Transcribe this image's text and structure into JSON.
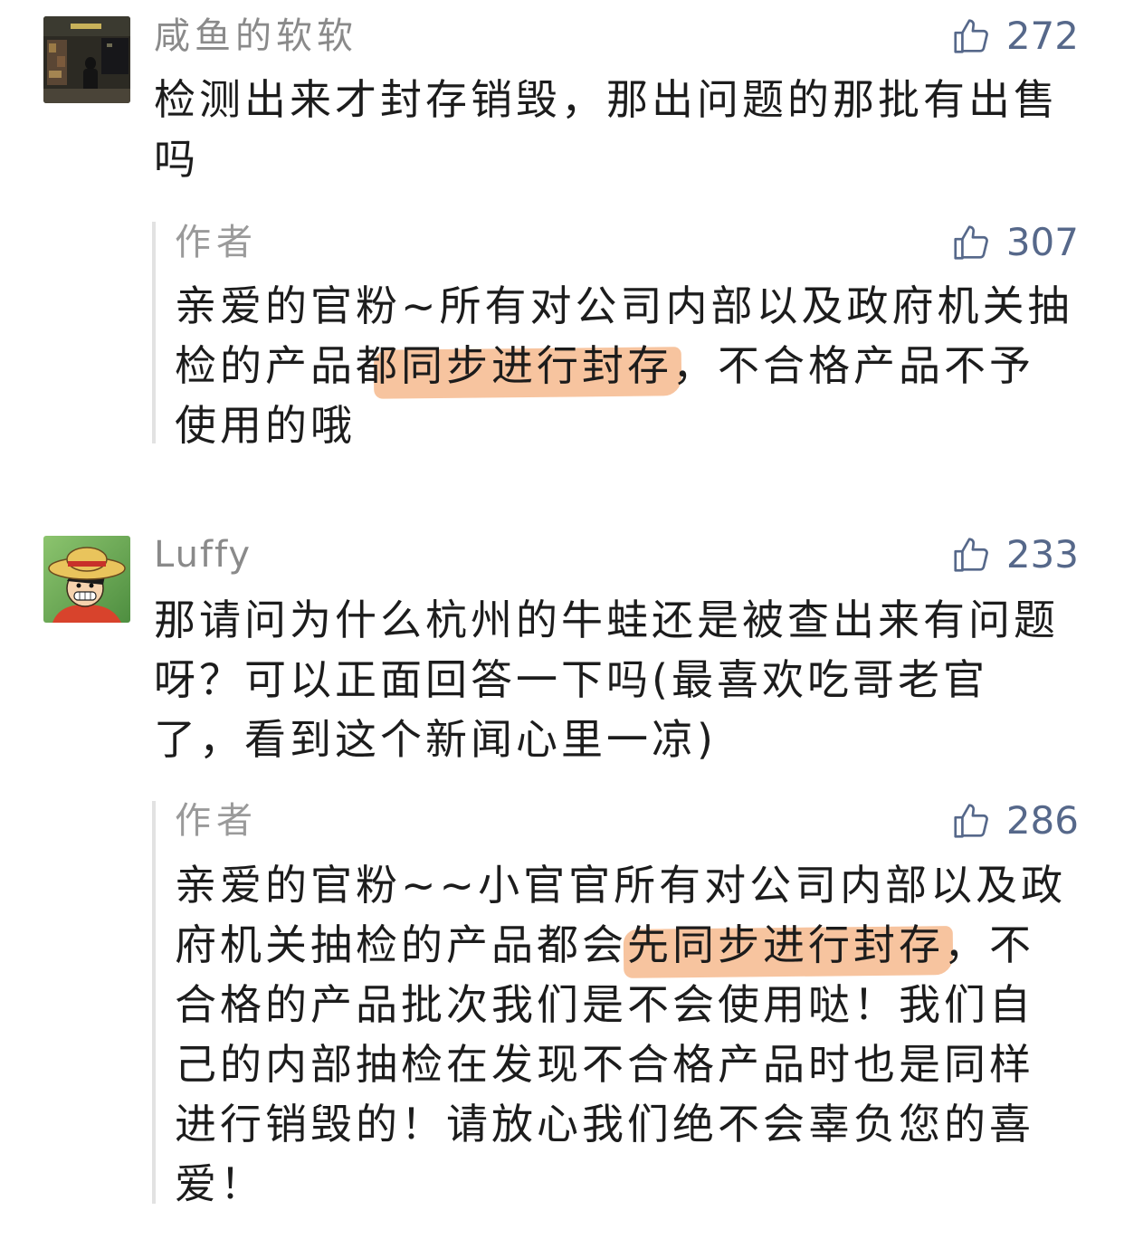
{
  "comments": [
    {
      "username": "咸鱼的软软",
      "likes": "272",
      "lines": [
        "检测出来才封存销毁，那出问题的那批有出售",
        "吗"
      ],
      "reply": {
        "author": "作者",
        "likes": "307",
        "lines": [
          "亲爱的官粉~所有对公司内部以及政府机关抽",
          {
            "before": "检的产品都",
            "highlight": "同步进行封存",
            "after": "，不合格产品不予"
          },
          "使用的哦"
        ]
      }
    },
    {
      "username": "Luffy",
      "likes": "233",
      "lines": [
        "那请问为什么杭州的牛蛙还是被查出来有问题",
        "呀？可以正面回答一下吗(最喜欢吃哥老官",
        "了，看到这个新闻心里一凉)"
      ],
      "reply": {
        "author": "作者",
        "likes": "286",
        "lines": [
          "亲爱的官粉~~小官官所有对公司内部以及政",
          {
            "before": "府机关抽检的产品都会",
            "highlight": "先同步进行封存",
            "after": "，不"
          },
          "合格的产品批次我们是不会使用哒！我们自",
          "己的内部抽检在发现不合格产品时也是同样",
          "进行销毁的！请放心我们绝不会辜负您的喜",
          "爱！"
        ]
      }
    }
  ],
  "icons": {
    "like": "thumbs-up-icon",
    "avatar_1": "street-photo-avatar",
    "avatar_2": "cartoon-straw-hat-avatar"
  },
  "colors": {
    "like": "#56688a",
    "username": "#8a8a8a",
    "text": "#1c1c1c",
    "highlight": "#f2a064",
    "reply_bar": "#e2e2e2"
  }
}
